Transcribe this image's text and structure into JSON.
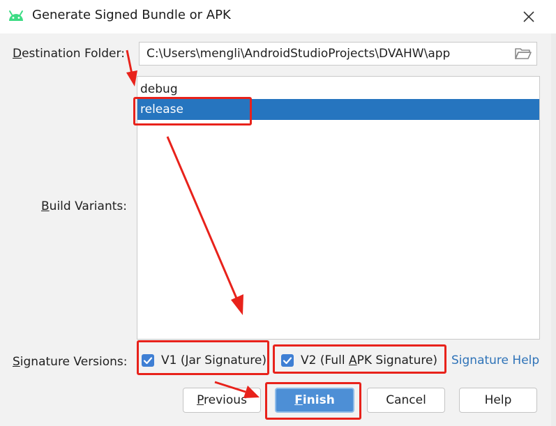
{
  "window": {
    "title": "Generate Signed Bundle or APK",
    "icon": "android-icon",
    "close_icon": "close-icon"
  },
  "destination": {
    "label_mnemonic": "D",
    "label_rest": "estination Folder:",
    "value": "C:\\Users\\mengli\\AndroidStudioProjects\\DVAHW\\app",
    "browse_icon": "folder-icon"
  },
  "build_variants": {
    "label_mnemonic": "B",
    "label_rest": "uild Variants:",
    "items": [
      {
        "label": "debug",
        "selected": false
      },
      {
        "label": "release",
        "selected": true
      }
    ]
  },
  "signature": {
    "label_mnemonic": "S",
    "label_rest": "ignature Versions:",
    "v1": {
      "prefix": "V1 (",
      "mnemonic": "J",
      "suffix": "ar Signature)",
      "checked": true
    },
    "v2": {
      "prefix": "V2 (Full ",
      "mnemonic": "A",
      "suffix": "PK Signature)",
      "checked": true
    },
    "help_link": "Signature Help"
  },
  "buttons": {
    "previous": {
      "mnemonic": "P",
      "rest": "revious"
    },
    "finish": {
      "mnemonic": "F",
      "rest": "inish"
    },
    "cancel": "Cancel",
    "help": "Help"
  },
  "colors": {
    "accent": "#2675bf",
    "annotation": "#e8221b",
    "link": "#2f73b8",
    "android_green": "#3ddc84"
  }
}
